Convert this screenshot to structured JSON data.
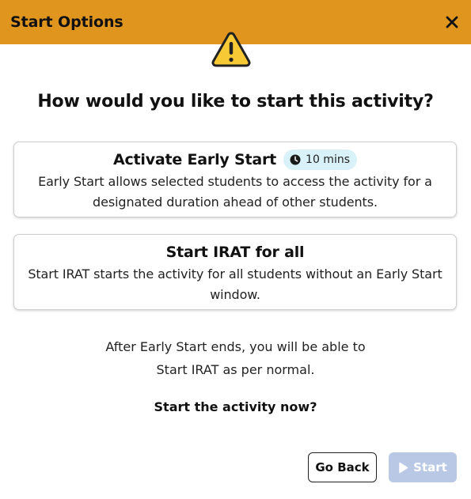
{
  "header": {
    "title": "Start Options",
    "close_glyph": "✕"
  },
  "icons": {
    "close": "close-icon",
    "warning": "warning-icon",
    "clock": "clock-icon",
    "play": "play-icon"
  },
  "question": "How would you like to start this activity?",
  "options": [
    {
      "title": "Activate Early Start",
      "badge": "10 mins",
      "description": "Early Start allows selected students to access the activity for a designated duration ahead of other students."
    },
    {
      "title": "Start IRAT for all",
      "description": "Start IRAT starts the activity for all students without an Early Start window."
    }
  ],
  "note": {
    "line1": "After Early Start ends, you will be able to",
    "line2": "Start IRAT as per normal."
  },
  "confirm": "Start the activity now?",
  "buttons": {
    "back": "Go Back",
    "start": "Start"
  },
  "colors": {
    "header_bg": "#E0951F",
    "warning_fill": "#F7C935",
    "badge_bg": "#D9F1F8",
    "start_disabled_bg": "#B9C8E4"
  }
}
